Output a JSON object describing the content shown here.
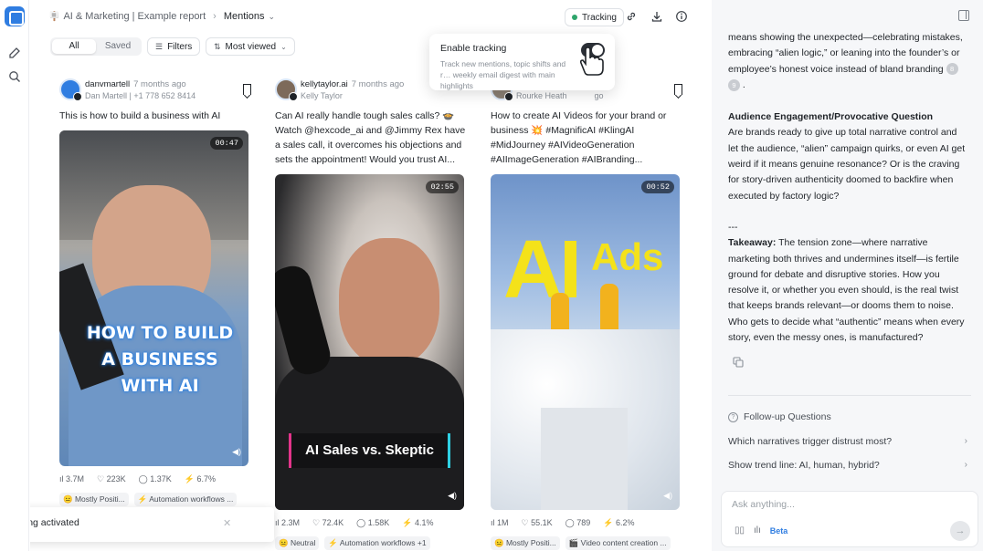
{
  "app": {
    "breadcrumb_emoji": "🪧",
    "breadcrumb_parent": "AI & Marketing | Example report",
    "breadcrumb_current": "Mentions"
  },
  "toolbar": {
    "tracking_label": "Tracking",
    "tracking_status_color": "#2ea56b"
  },
  "filters": {
    "segment_all": "All",
    "segment_saved": "Saved",
    "filters_label": "Filters",
    "sort_label": "Most viewed"
  },
  "tooltip": {
    "title": "Enable tracking",
    "description": "Track new mentions, topic shifts and r… weekly email digest with main highlights"
  },
  "cards": [
    {
      "username": "danvmartell",
      "time": "7 months ago",
      "subtitle": "Dan Martell | +1 778 652 8414",
      "text": "This is how to build a business with AI",
      "duration": "00:47",
      "overlay": "HOW TO BUILD A BUSINESS WITH AI",
      "views": "3.7M",
      "likes": "223K",
      "comments": "1.37K",
      "engagement": "6.7%",
      "sentiment": "😐 Mostly Positi...",
      "topic": "⚡ Automation workflows ..."
    },
    {
      "username": "kellytaylor.ai",
      "time": "7 months ago",
      "subtitle": "Kelly Taylor",
      "text": "Can AI really handle tough sales calls? 🍲 Watch @hexcode_ai and @Jimmy Rex have a sales call, it overcomes his objections and sets the appointment! Would you trust AI...",
      "duration": "02:55",
      "overlay": "AI Sales vs. Skeptic",
      "views": "2.3M",
      "likes": "72.4K",
      "comments": "1.58K",
      "engagement": "4.1%",
      "sentiment": "😐 Neutral",
      "topic": "⚡ Automation workflows +1"
    },
    {
      "username": "",
      "time": "",
      "subtitle": "Rourke Heath",
      "time_suffix": "go",
      "text": "How to create AI Videos for your brand or business 💥 #MagnificAI #KlingAI #MidJourney #AIVideoGeneration #AIImageGeneration #AIBranding...",
      "duration": "00:52",
      "overlay_big": "AI",
      "overlay_small": "Ads",
      "views": "1M",
      "likes": "55.1K",
      "comments": "789",
      "engagement": "6.2%",
      "sentiment": "😐 Mostly Positi...",
      "topic": "🎬 Video content creation ..."
    }
  ],
  "toast": {
    "text": "Tracking activated"
  },
  "panel": {
    "para1_a": "means showing the unexpected—celebrating mistakes, embracing “alien logic,” or leaning into the founder’s or employee’s honest voice instead of bland branding",
    "ref8": "8",
    "ref9": "9",
    "para1_end": ".",
    "heading": "Audience Engagement/Provocative Question",
    "para2": "Are brands ready to give up total narrative control and let the audience, “alien” campaign quirks, or even AI get weird if it means genuine resonance? Or is the craving for story-driven authenticity doomed to backfire when executed by factory logic?",
    "separator": "---",
    "takeaway_label": "Takeaway:",
    "takeaway_text": "The tension zone—where narrative marketing both thrives and undermines itself—is fertile ground for debate and disruptive stories. How you resolve it, or whether you even should, is the real twist that keeps brands relevant—or dooms them to noise. Who gets to decide what “authentic” means when every story, even the messy ones, is manufactured?",
    "followup_title": "Follow-up Questions",
    "followups": [
      "Which narratives trigger distrust most?",
      "Show trend line: AI, human, hybrid?"
    ],
    "ask_placeholder": "Ask anything...",
    "beta_label": "Beta"
  }
}
